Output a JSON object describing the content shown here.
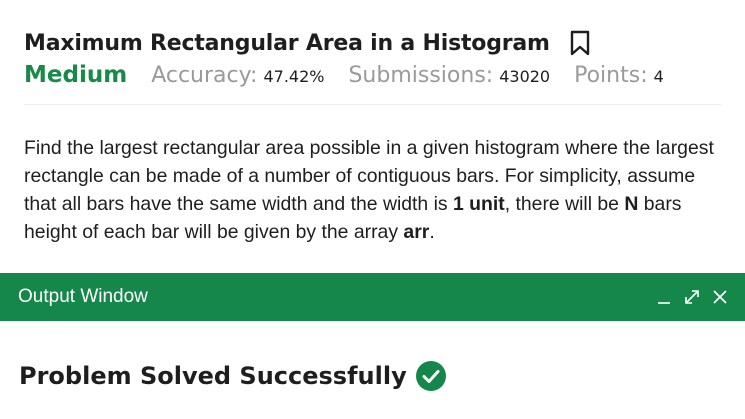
{
  "problem": {
    "title": "Maximum Rectangular Area in a Histogram",
    "difficulty": "Medium",
    "accuracy_label": "Accuracy:",
    "accuracy_value": "47.42%",
    "submissions_label": "Submissions:",
    "submissions_value": "43020",
    "points_label": "Points:",
    "points_value": "4",
    "description": {
      "p1": "Find the largest rectangular area possible in a given histogram where the largest rectangle can be made of a number of contiguous bars. For simplicity, assume that all bars have the same width and the width is ",
      "b1": "1 unit",
      "p2": ", there will be ",
      "b2": "N",
      "p3": " bars height of each bar will be given by the array ",
      "b3": "arr",
      "p4": "."
    }
  },
  "output_window": {
    "title": "Output Window",
    "result": "Problem Solved Successfully"
  },
  "icons": {
    "bookmark": "bookmark-icon",
    "minimize": "minimize-icon",
    "expand": "expand-icon",
    "close": "close-icon",
    "success": "check-circle-icon"
  },
  "colors": {
    "accent_green": "#178a48",
    "bar_green": "#15874a",
    "muted_text": "#9a9a9a"
  }
}
